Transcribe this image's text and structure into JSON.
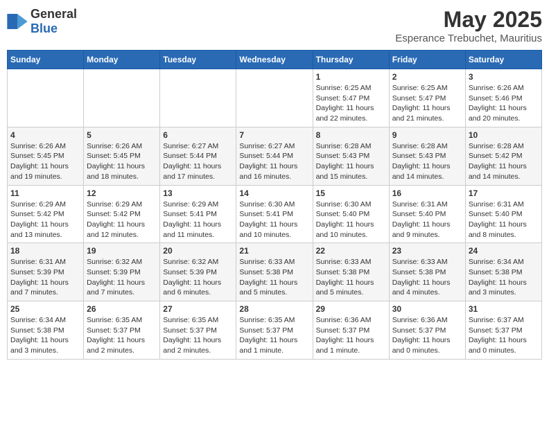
{
  "header": {
    "logo_general": "General",
    "logo_blue": "Blue",
    "title": "May 2025",
    "subtitle": "Esperance Trebuchet, Mauritius"
  },
  "days_of_week": [
    "Sunday",
    "Monday",
    "Tuesday",
    "Wednesday",
    "Thursday",
    "Friday",
    "Saturday"
  ],
  "weeks": [
    [
      {
        "day": "",
        "info": ""
      },
      {
        "day": "",
        "info": ""
      },
      {
        "day": "",
        "info": ""
      },
      {
        "day": "",
        "info": ""
      },
      {
        "day": "1",
        "info": "Sunrise: 6:25 AM\nSunset: 5:47 PM\nDaylight: 11 hours and 22 minutes."
      },
      {
        "day": "2",
        "info": "Sunrise: 6:25 AM\nSunset: 5:47 PM\nDaylight: 11 hours and 21 minutes."
      },
      {
        "day": "3",
        "info": "Sunrise: 6:26 AM\nSunset: 5:46 PM\nDaylight: 11 hours and 20 minutes."
      }
    ],
    [
      {
        "day": "4",
        "info": "Sunrise: 6:26 AM\nSunset: 5:45 PM\nDaylight: 11 hours and 19 minutes."
      },
      {
        "day": "5",
        "info": "Sunrise: 6:26 AM\nSunset: 5:45 PM\nDaylight: 11 hours and 18 minutes."
      },
      {
        "day": "6",
        "info": "Sunrise: 6:27 AM\nSunset: 5:44 PM\nDaylight: 11 hours and 17 minutes."
      },
      {
        "day": "7",
        "info": "Sunrise: 6:27 AM\nSunset: 5:44 PM\nDaylight: 11 hours and 16 minutes."
      },
      {
        "day": "8",
        "info": "Sunrise: 6:28 AM\nSunset: 5:43 PM\nDaylight: 11 hours and 15 minutes."
      },
      {
        "day": "9",
        "info": "Sunrise: 6:28 AM\nSunset: 5:43 PM\nDaylight: 11 hours and 14 minutes."
      },
      {
        "day": "10",
        "info": "Sunrise: 6:28 AM\nSunset: 5:42 PM\nDaylight: 11 hours and 14 minutes."
      }
    ],
    [
      {
        "day": "11",
        "info": "Sunrise: 6:29 AM\nSunset: 5:42 PM\nDaylight: 11 hours and 13 minutes."
      },
      {
        "day": "12",
        "info": "Sunrise: 6:29 AM\nSunset: 5:42 PM\nDaylight: 11 hours and 12 minutes."
      },
      {
        "day": "13",
        "info": "Sunrise: 6:29 AM\nSunset: 5:41 PM\nDaylight: 11 hours and 11 minutes."
      },
      {
        "day": "14",
        "info": "Sunrise: 6:30 AM\nSunset: 5:41 PM\nDaylight: 11 hours and 10 minutes."
      },
      {
        "day": "15",
        "info": "Sunrise: 6:30 AM\nSunset: 5:40 PM\nDaylight: 11 hours and 10 minutes."
      },
      {
        "day": "16",
        "info": "Sunrise: 6:31 AM\nSunset: 5:40 PM\nDaylight: 11 hours and 9 minutes."
      },
      {
        "day": "17",
        "info": "Sunrise: 6:31 AM\nSunset: 5:40 PM\nDaylight: 11 hours and 8 minutes."
      }
    ],
    [
      {
        "day": "18",
        "info": "Sunrise: 6:31 AM\nSunset: 5:39 PM\nDaylight: 11 hours and 7 minutes."
      },
      {
        "day": "19",
        "info": "Sunrise: 6:32 AM\nSunset: 5:39 PM\nDaylight: 11 hours and 7 minutes."
      },
      {
        "day": "20",
        "info": "Sunrise: 6:32 AM\nSunset: 5:39 PM\nDaylight: 11 hours and 6 minutes."
      },
      {
        "day": "21",
        "info": "Sunrise: 6:33 AM\nSunset: 5:38 PM\nDaylight: 11 hours and 5 minutes."
      },
      {
        "day": "22",
        "info": "Sunrise: 6:33 AM\nSunset: 5:38 PM\nDaylight: 11 hours and 5 minutes."
      },
      {
        "day": "23",
        "info": "Sunrise: 6:33 AM\nSunset: 5:38 PM\nDaylight: 11 hours and 4 minutes."
      },
      {
        "day": "24",
        "info": "Sunrise: 6:34 AM\nSunset: 5:38 PM\nDaylight: 11 hours and 3 minutes."
      }
    ],
    [
      {
        "day": "25",
        "info": "Sunrise: 6:34 AM\nSunset: 5:38 PM\nDaylight: 11 hours and 3 minutes."
      },
      {
        "day": "26",
        "info": "Sunrise: 6:35 AM\nSunset: 5:37 PM\nDaylight: 11 hours and 2 minutes."
      },
      {
        "day": "27",
        "info": "Sunrise: 6:35 AM\nSunset: 5:37 PM\nDaylight: 11 hours and 2 minutes."
      },
      {
        "day": "28",
        "info": "Sunrise: 6:35 AM\nSunset: 5:37 PM\nDaylight: 11 hours and 1 minute."
      },
      {
        "day": "29",
        "info": "Sunrise: 6:36 AM\nSunset: 5:37 PM\nDaylight: 11 hours and 1 minute."
      },
      {
        "day": "30",
        "info": "Sunrise: 6:36 AM\nSunset: 5:37 PM\nDaylight: 11 hours and 0 minutes."
      },
      {
        "day": "31",
        "info": "Sunrise: 6:37 AM\nSunset: 5:37 PM\nDaylight: 11 hours and 0 minutes."
      }
    ]
  ]
}
